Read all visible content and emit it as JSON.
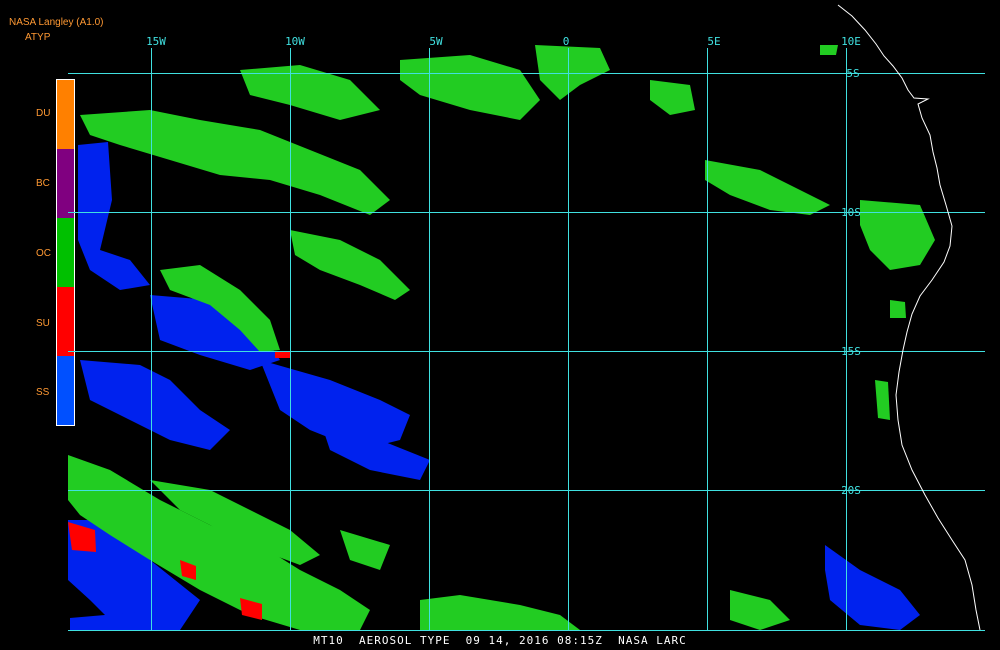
{
  "header": {
    "line1": "NASA Langley (A1.0)",
    "line2": "ATYP"
  },
  "legend": {
    "items": [
      {
        "code": "DU",
        "color": "#ff8000"
      },
      {
        "code": "BC",
        "color": "#800080"
      },
      {
        "code": "OC",
        "color": "#00c000"
      },
      {
        "code": "SU",
        "color": "#ff0000"
      },
      {
        "code": "SS",
        "color": "#0050ff"
      }
    ]
  },
  "grid": {
    "lon_labels": [
      "15W",
      "10W",
      "5W",
      "0",
      "5E",
      "10E"
    ],
    "lat_labels": [
      "5S",
      "10S",
      "15S",
      "20S"
    ]
  },
  "colors": {
    "grid": "#40e0e0",
    "coast": "#ffffff",
    "oc": "#22cc22",
    "ss": "#0022ee",
    "su": "#ff0000"
  },
  "footer": {
    "text": "MT10  AEROSOL TYPE  09 14, 2016 08:15Z  NASA LARC"
  }
}
